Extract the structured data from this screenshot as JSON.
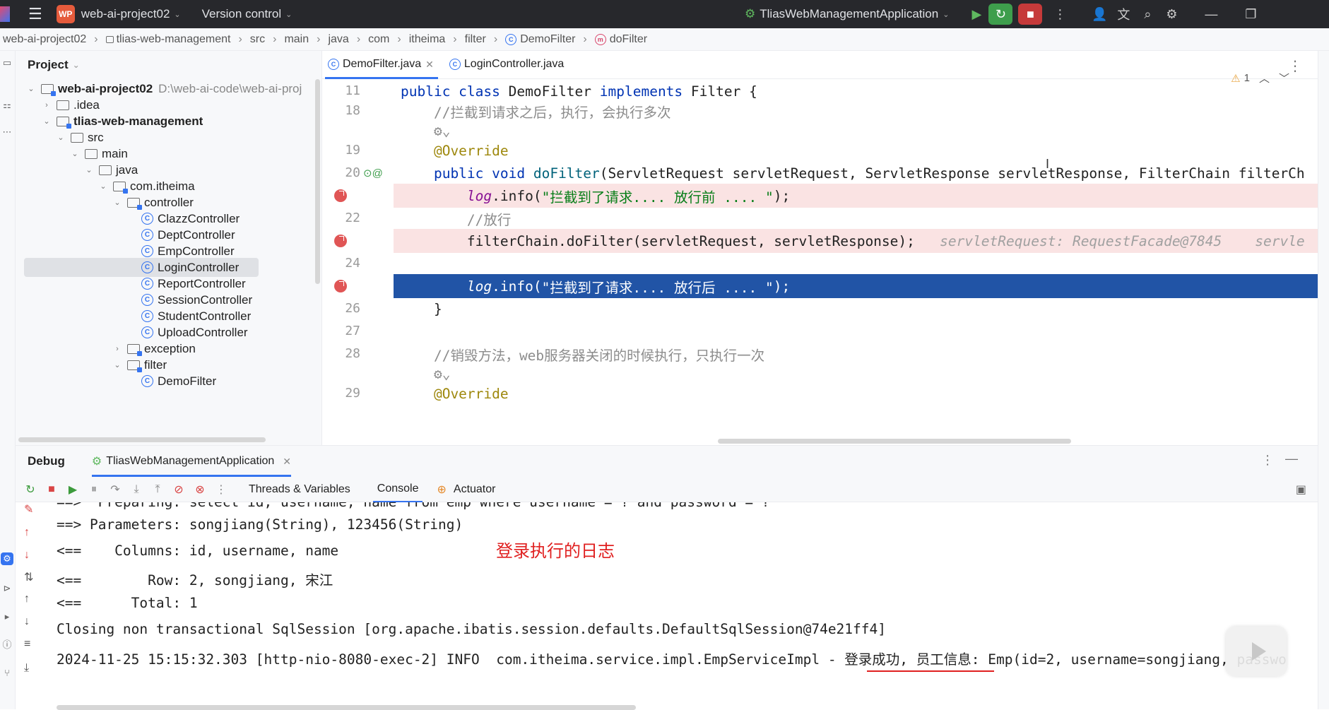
{
  "titlebar": {
    "project_badge": "WP",
    "project_name": "web-ai-project02",
    "vcs": "Version control",
    "run_config": "TliasWebManagementApplication"
  },
  "breadcrumb": [
    "web-ai-project02",
    "tlias-web-management",
    "src",
    "main",
    "java",
    "com",
    "itheima",
    "filter",
    "DemoFilter",
    "doFilter"
  ],
  "project_panel": {
    "title": "Project",
    "tree": [
      {
        "label": "web-ai-project02",
        "extra": "D:\\web-ai-code\\web-ai-proj",
        "type": "module",
        "bold": true,
        "expanded": true
      },
      {
        "label": ".idea",
        "type": "folder",
        "expanded": false
      },
      {
        "label": "tlias-web-management",
        "type": "module",
        "bold": true,
        "expanded": true
      },
      {
        "label": "src",
        "type": "folder",
        "expanded": true
      },
      {
        "label": "main",
        "type": "folder",
        "expanded": true
      },
      {
        "label": "java",
        "type": "folder",
        "expanded": true
      },
      {
        "label": "com.itheima",
        "type": "package",
        "expanded": true
      },
      {
        "label": "controller",
        "type": "package",
        "expanded": true
      },
      {
        "label": "ClazzController",
        "type": "class"
      },
      {
        "label": "DeptController",
        "type": "class"
      },
      {
        "label": "EmpController",
        "type": "class"
      },
      {
        "label": "LoginController",
        "type": "class",
        "selected": true
      },
      {
        "label": "ReportController",
        "type": "class"
      },
      {
        "label": "SessionController",
        "type": "class"
      },
      {
        "label": "StudentController",
        "type": "class"
      },
      {
        "label": "UploadController",
        "type": "class"
      },
      {
        "label": "exception",
        "type": "package",
        "expanded": false
      },
      {
        "label": "filter",
        "type": "package",
        "expanded": true
      },
      {
        "label": "DemoFilter",
        "type": "class"
      }
    ]
  },
  "editor": {
    "tabs": [
      {
        "label": "DemoFilter.java",
        "active": true
      },
      {
        "label": "LoginController.java",
        "active": false
      }
    ],
    "warnings": "1",
    "lines": [
      {
        "n": "11",
        "parts": [
          [
            "kw",
            "public class "
          ],
          [
            "",
            "DemoFilter "
          ],
          [
            "kw",
            "implements "
          ],
          [
            "",
            "Filter {"
          ]
        ]
      },
      {
        "n": "18",
        "parts": [
          [
            "cmt",
            "    //拦截到请求之后，执行，会执行多次"
          ]
        ]
      },
      {
        "n": "",
        "parts": [
          [
            "cmt",
            "    ⚙⌄"
          ]
        ]
      },
      {
        "n": "19",
        "parts": [
          [
            "ann",
            "    @Override"
          ]
        ]
      },
      {
        "n": "20",
        "parts": [
          [
            "kw",
            "    public void "
          ],
          [
            "fn",
            "doFilter"
          ],
          [
            "",
            "(ServletRequest servletRequest, ServletResponse servletResponse, FilterChain filterCh"
          ]
        ]
      },
      {
        "n": "",
        "bp": true,
        "parts": [
          [
            "lg",
            "        log"
          ],
          [
            "",
            ".info("
          ],
          [
            "str",
            "\"拦截到了请求.... 放行前 .... \""
          ],
          [
            "",
            ");"
          ]
        ]
      },
      {
        "n": "22",
        "parts": [
          [
            "cmt",
            "        //放行"
          ]
        ]
      },
      {
        "n": "",
        "bp": true,
        "parts": [
          [
            "",
            "        filterChain.doFilter(servletRequest, servletResponse);"
          ],
          [
            "hint",
            "   servletRequest: RequestFacade@7845    servle"
          ]
        ]
      },
      {
        "n": "24",
        "parts": [
          [
            "",
            ""
          ]
        ]
      },
      {
        "n": "",
        "cur": true,
        "parts": [
          [
            "lg",
            "        log"
          ],
          [
            "",
            ".info("
          ],
          [
            "str",
            "\"拦截到了请求.... 放行后 .... \""
          ],
          [
            "",
            ");"
          ]
        ]
      },
      {
        "n": "26",
        "parts": [
          [
            "",
            "    }"
          ]
        ]
      },
      {
        "n": "27",
        "parts": [
          [
            "",
            ""
          ]
        ]
      },
      {
        "n": "28",
        "parts": [
          [
            "cmt",
            "    //销毁方法，web服务器关闭的时候执行，只执行一次"
          ]
        ]
      },
      {
        "n": "",
        "parts": [
          [
            "cmt",
            "    ⚙⌄"
          ]
        ]
      },
      {
        "n": "29",
        "parts": [
          [
            "ann",
            "    @Override"
          ]
        ]
      }
    ]
  },
  "debug": {
    "title": "Debug",
    "session_tab": "TliasWebManagementApplication",
    "view_tabs": [
      "Threads & Variables",
      "Console",
      "Actuator"
    ],
    "console_lines": [
      "==>  Preparing: select id, username, name from emp where username = ? and password = ?",
      "==> Parameters: songjiang(String), 123456(String)",
      "<==    Columns: id, username, name",
      "<==        Row: 2, songjiang, 宋江",
      "<==      Total: 1",
      "Closing non transactional SqlSession [org.apache.ibatis.session.defaults.DefaultSqlSession@74e21ff4]",
      "2024-11-25 15:15:32.303 [http-nio-8080-exec-2] INFO  com.itheima.service.impl.EmpServiceImpl - 登录成功, 员工信息: Emp(id=2, username=songjiang, passwo"
    ],
    "annotation": "登录执行的日志"
  }
}
